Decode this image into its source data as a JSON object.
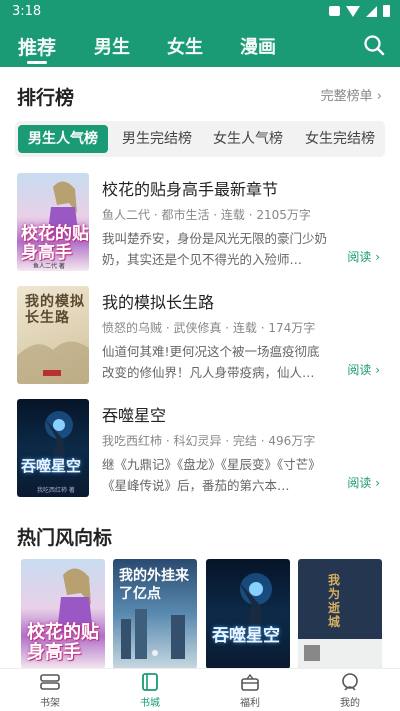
{
  "status": {
    "time": "3:18"
  },
  "nav": {
    "tabs": [
      {
        "label": "推荐"
      },
      {
        "label": "男生"
      },
      {
        "label": "女生"
      },
      {
        "label": "漫画"
      }
    ]
  },
  "ranking": {
    "title": "排行榜",
    "full_list": "完整榜单 ›",
    "tabs": [
      {
        "label": "男生人气榜"
      },
      {
        "label": "男生完结榜"
      },
      {
        "label": "女生人气榜"
      },
      {
        "label": "女生完结榜"
      }
    ],
    "books": [
      {
        "title": "校花的贴身高手最新章节",
        "meta": "鱼人二代 · 都市生活 · 连载 · 2105万字",
        "desc": "我叫楚乔安，身份是风光无限的豪门少奶奶，其实还是个见不得光的入殓师…",
        "read": "阅读 ›",
        "cover_text": "校花的贴身高手",
        "cover_author": "鱼人二代 著"
      },
      {
        "title": "我的模拟长生路",
        "meta": "愤怒的乌贼 · 武侠修真 · 连载 · 174万字",
        "desc": "仙道何其难!更何况这个被一场瘟疫彻底改变的修仙界！凡人身带疫病，仙人…",
        "read": "阅读 ›",
        "cover_text": "我的模拟长生路"
      },
      {
        "title": "吞噬星空",
        "meta": "我吃西红柿 · 科幻灵异 · 完结 · 496万字",
        "desc": "继《九鼎记》《盘龙》《星辰变》《寸芒》《星峰传说》后，番茄的第六本…",
        "read": "阅读 ›",
        "cover_text": "吞噬星空",
        "cover_author": "我吃西红柿 著"
      }
    ]
  },
  "hot": {
    "title": "热门风向标",
    "covers": [
      {
        "text": "校花的贴身高手"
      },
      {
        "text": "我的外挂来了亿点"
      },
      {
        "text": "吞噬星空"
      },
      {
        "text": "我为逝城"
      }
    ]
  },
  "bottom_nav": [
    {
      "label": "书架"
    },
    {
      "label": "书城"
    },
    {
      "label": "福利"
    },
    {
      "label": "我的"
    }
  ]
}
